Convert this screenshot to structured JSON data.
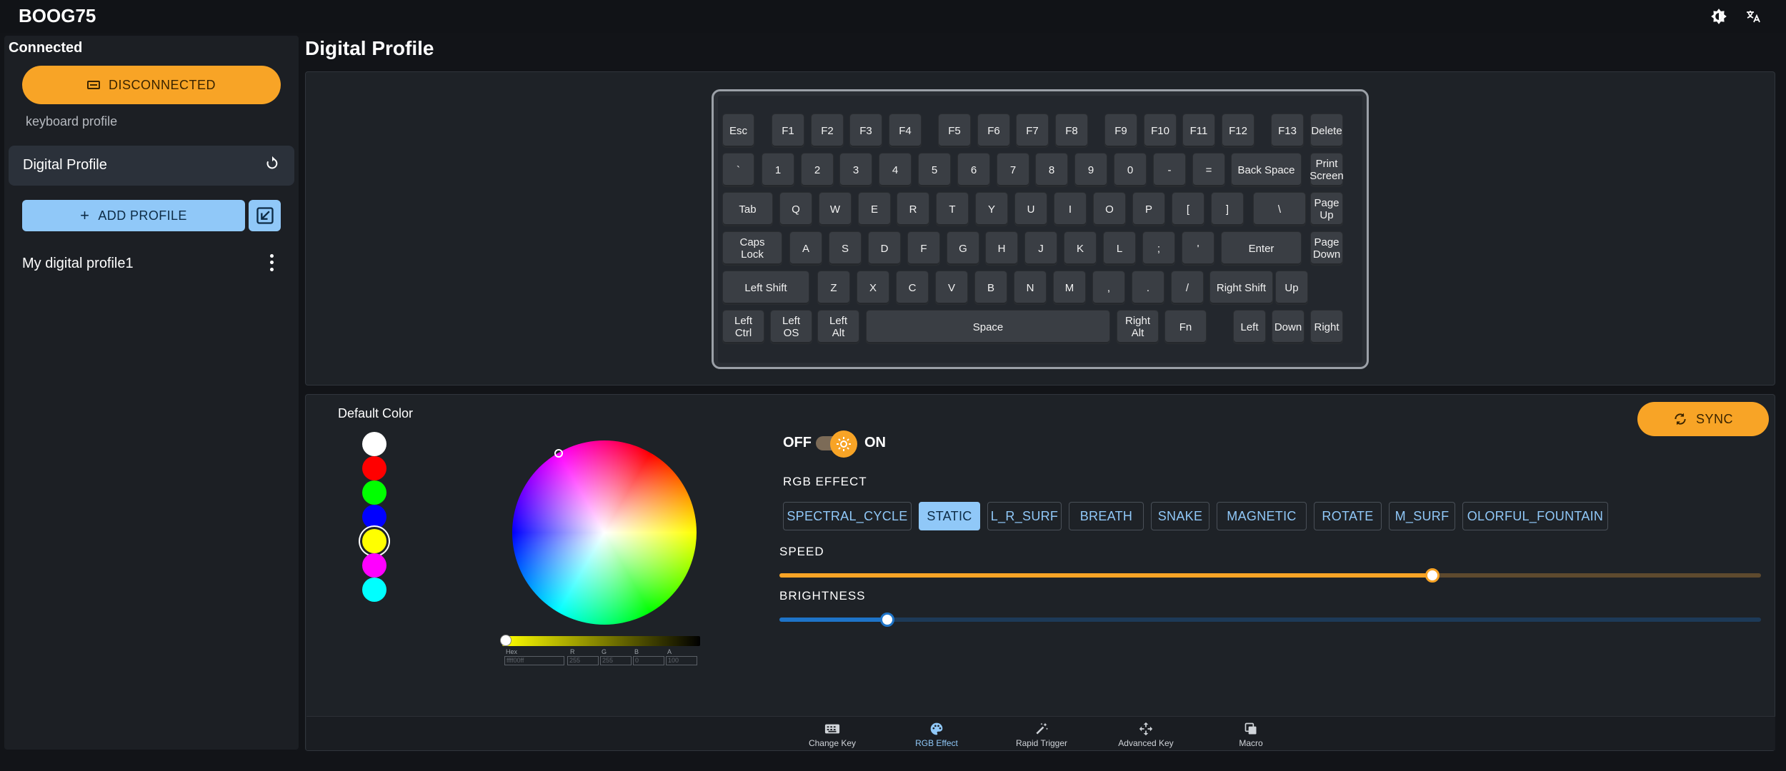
{
  "app": {
    "title": "BOOG75"
  },
  "top_icons": [
    "brightness-icon",
    "translate-icon"
  ],
  "sidebar": {
    "status": "Connected",
    "disconnect_label": "DISCONNECTED",
    "section_label": "keyboard profile",
    "active_profile": "Digital Profile",
    "add_profile_label": "ADD PROFILE",
    "profiles": [
      {
        "label": "My digital profile1"
      }
    ]
  },
  "main": {
    "title": "Digital Profile"
  },
  "keyboard": {
    "rows": [
      [
        "Esc",
        "F1",
        "F2",
        "F3",
        "F4",
        "F5",
        "F6",
        "F7",
        "F8",
        "F9",
        "F10",
        "F11",
        "F12",
        "F13",
        "Delete"
      ],
      [
        "`",
        "1",
        "2",
        "3",
        "4",
        "5",
        "6",
        "7",
        "8",
        "9",
        "0",
        "-",
        "=",
        "Back Space",
        "Print Screen"
      ],
      [
        "Tab",
        "Q",
        "W",
        "E",
        "R",
        "T",
        "Y",
        "U",
        "I",
        "O",
        "P",
        "[",
        "]",
        "\\",
        "Page Up"
      ],
      [
        "Caps Lock",
        "A",
        "S",
        "D",
        "F",
        "G",
        "H",
        "J",
        "K",
        "L",
        ";",
        "'",
        "Enter",
        "Page Down"
      ],
      [
        "Left Shift",
        "Z",
        "X",
        "C",
        "V",
        "B",
        "N",
        "M",
        ",",
        ".",
        "/",
        "Right Shift",
        "Up"
      ],
      [
        "Left Ctrl",
        "Left OS",
        "Left Alt",
        "Space",
        "Right Alt",
        "Fn",
        "Left",
        "Down",
        "Right"
      ]
    ]
  },
  "rgb": {
    "default_color_label": "Default Color",
    "default_colors": [
      "#ffffff",
      "#ff0000",
      "#00ff00",
      "#0000ff",
      "#ffff00",
      "#ff00ff",
      "#00ffff"
    ],
    "selected_color_index": 4,
    "picker": {
      "hex_label": "Hex",
      "r_label": "R",
      "g_label": "G",
      "b_label": "B",
      "a_label": "A",
      "hex": "ffff00ff",
      "r": "255",
      "g": "255",
      "b": "0",
      "a": "100"
    },
    "toggle_off": "OFF",
    "toggle_on": "ON",
    "effect_label": "RGB EFFECT",
    "effects": [
      "SPECTRAL_CYCLE",
      "STATIC",
      "L_R_SURF",
      "BREATH",
      "SNAKE",
      "MAGNETIC",
      "ROTATE",
      "M_SURF",
      "OLORFUL_FOUNTAIN"
    ],
    "active_effect": "STATIC",
    "speed_label": "SPEED",
    "speed_fraction": 0.665,
    "brightness_label": "BRIGHTNESS",
    "brightness_fraction": 0.11,
    "sync_label": "SYNC",
    "colors": {
      "accent_orange": "#f8a426",
      "accent_blue": "#90c8f8",
      "brightness_blue": "#1e74c8"
    }
  },
  "bottom_nav": [
    {
      "label": "Change Key",
      "icon": "keyboard-icon"
    },
    {
      "label": "RGB Effect",
      "icon": "palette-icon",
      "active": true
    },
    {
      "label": "Rapid Trigger",
      "icon": "magic-wand-icon"
    },
    {
      "label": "Advanced Key",
      "icon": "move-arrows-icon"
    },
    {
      "label": "Macro",
      "icon": "copy-layers-icon"
    }
  ]
}
